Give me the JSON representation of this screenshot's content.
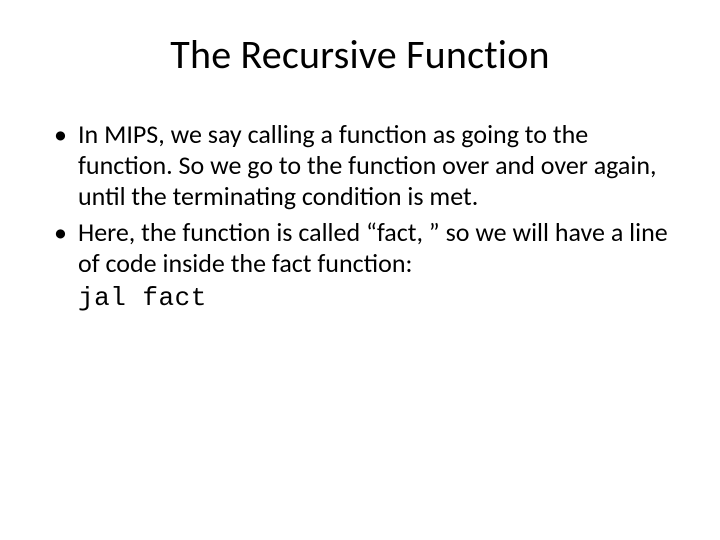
{
  "title": "The Recursive Function",
  "bullets": [
    "In MIPS, we say calling a function as going to the function. So we go to the function over and over again, until the terminating condition is met.",
    "Here, the function is called “fact, ” so we will have a line of code inside the fact function:"
  ],
  "code": "jal fact"
}
